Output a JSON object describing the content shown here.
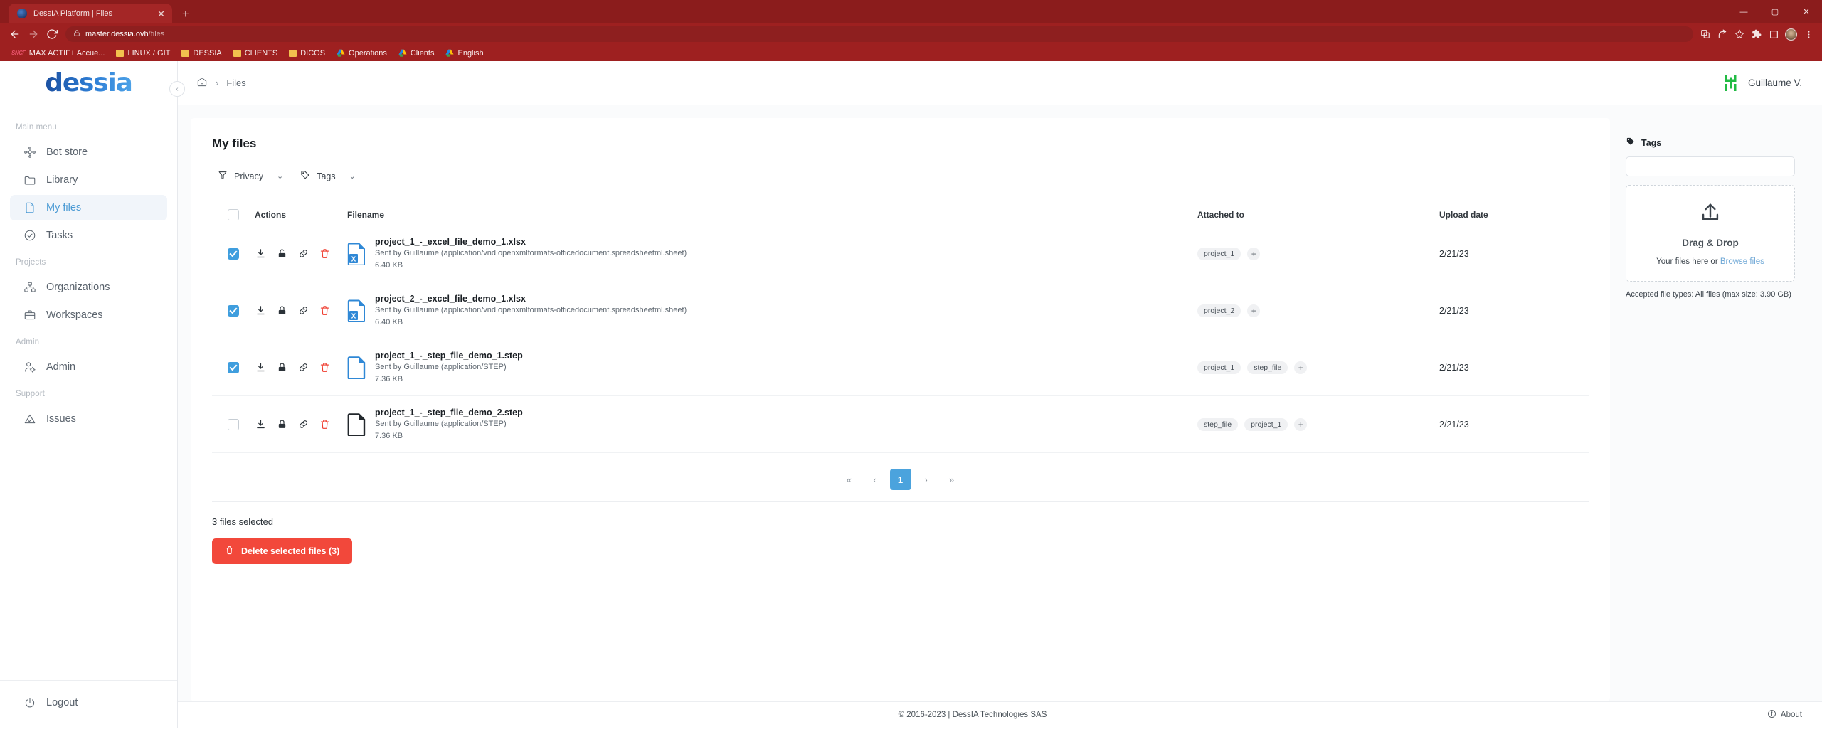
{
  "browser": {
    "tab_title": "DessIA Platform | Files",
    "tab_close": "✕",
    "new_tab": "+",
    "url_host": "master.dessia.ovh",
    "url_path": "/files",
    "win_minimize": "—",
    "win_maximize": "▢",
    "win_close": "✕",
    "bookmarks": [
      {
        "label": "MAX ACTIF+ Accue...",
        "icon": "sncf-icon"
      },
      {
        "label": "LINUX / GIT",
        "icon": "folder-icon"
      },
      {
        "label": "DESSIA",
        "icon": "folder-icon"
      },
      {
        "label": "CLIENTS",
        "icon": "folder-icon"
      },
      {
        "label": "DICOS",
        "icon": "folder-icon"
      },
      {
        "label": "Operations",
        "icon": "drive-icon"
      },
      {
        "label": "Clients",
        "icon": "drive-icon"
      },
      {
        "label": "English",
        "icon": "drive-icon"
      }
    ]
  },
  "sidebar": {
    "logo": "dessia",
    "collapse": "‹",
    "sections": [
      {
        "title": "Main menu",
        "items": [
          {
            "label": "Bot store",
            "icon": "bot-store-icon",
            "active": false
          },
          {
            "label": "Library",
            "icon": "folder-icon",
            "active": false
          },
          {
            "label": "My files",
            "icon": "file-icon",
            "active": true
          },
          {
            "label": "Tasks",
            "icon": "check-circle-icon",
            "active": false
          }
        ]
      },
      {
        "title": "Projects",
        "items": [
          {
            "label": "Organizations",
            "icon": "org-chart-icon",
            "active": false
          },
          {
            "label": "Workspaces",
            "icon": "briefcase-icon",
            "active": false
          }
        ]
      },
      {
        "title": "Admin",
        "items": [
          {
            "label": "Admin",
            "icon": "user-gear-icon",
            "active": false
          }
        ]
      },
      {
        "title": "Support",
        "items": [
          {
            "label": "Issues",
            "icon": "warning-triangle-icon",
            "active": false
          }
        ]
      }
    ],
    "logout": {
      "label": "Logout",
      "icon": "power-icon"
    }
  },
  "topbar": {
    "breadcrumb_home": "home-icon",
    "breadcrumb_sep": "›",
    "breadcrumb_current": "Files",
    "username": "Guillaume V.",
    "avatar_color": "#22bb44"
  },
  "main": {
    "page_title": "My files",
    "filters": [
      {
        "label": "Privacy",
        "icon": "filter-icon",
        "caret": "⌄"
      },
      {
        "label": "Tags",
        "icon": "tag-icon",
        "caret": "⌄"
      }
    ],
    "table": {
      "headers": {
        "checkbox": "",
        "actions": "Actions",
        "filename": "Filename",
        "attached_to": "Attached to",
        "upload_date": "Upload date"
      },
      "rows": [
        {
          "selected": true,
          "actions": [
            "download-icon",
            "unlock-icon",
            "link-icon",
            "trash-icon"
          ],
          "lock_state": "unlocked",
          "file_icon": "excel-file-icon",
          "name": "project_1_-_excel_file_demo_1.xlsx",
          "sub": "Sent by Guillaume (application/vnd.openxmlformats-officedocument.spreadsheetml.sheet)",
          "size": "6.40 KB",
          "tags": [
            "project_1"
          ],
          "add_tag": "+",
          "date": "2/21/23"
        },
        {
          "selected": true,
          "actions": [
            "download-icon",
            "lock-icon",
            "link-icon",
            "trash-icon"
          ],
          "lock_state": "locked",
          "file_icon": "excel-file-icon",
          "name": "project_2_-_excel_file_demo_1.xlsx",
          "sub": "Sent by Guillaume (application/vnd.openxmlformats-officedocument.spreadsheetml.sheet)",
          "size": "6.40 KB",
          "tags": [
            "project_2"
          ],
          "add_tag": "+",
          "date": "2/21/23"
        },
        {
          "selected": true,
          "actions": [
            "download-icon",
            "lock-icon",
            "link-icon",
            "trash-icon"
          ],
          "lock_state": "locked",
          "file_icon": "step-file-icon-blue",
          "name": "project_1_-_step_file_demo_1.step",
          "sub": "Sent by Guillaume (application/STEP)",
          "size": "7.36 KB",
          "tags": [
            "project_1",
            "step_file"
          ],
          "add_tag": "+",
          "date": "2/21/23"
        },
        {
          "selected": false,
          "actions": [
            "download-icon",
            "lock-icon",
            "link-icon",
            "trash-icon"
          ],
          "lock_state": "locked",
          "file_icon": "step-file-icon-dark",
          "name": "project_1_-_step_file_demo_2.step",
          "sub": "Sent by Guillaume (application/STEP)",
          "size": "7.36 KB",
          "tags": [
            "step_file",
            "project_1"
          ],
          "add_tag": "+",
          "date": "2/21/23"
        }
      ]
    },
    "pagination": {
      "first": "«",
      "prev": "‹",
      "pages": [
        "1"
      ],
      "current": "1",
      "next": "›",
      "last": "»"
    },
    "selection": {
      "count_text": "3 files selected",
      "delete_label": "Delete selected files (3)",
      "delete_color": "#f2483b"
    }
  },
  "right_panel": {
    "title": "Tags",
    "tag_input_value": "",
    "tag_input_placeholder": "",
    "dropzone_title": "Drag & Drop",
    "dropzone_sub": "Your files here or",
    "dropzone_link": "Browse files",
    "accepted": "Accepted file types: All files (max size: 3.90 GB)"
  },
  "footer": {
    "copyright": "© 2016-2023 | DessIA Technologies SAS",
    "about": "About"
  }
}
